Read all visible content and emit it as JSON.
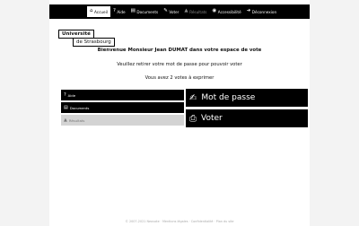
{
  "nav": {
    "items": [
      {
        "icon": "home-icon",
        "glyph": "⌂",
        "label": "Accueil",
        "active": true,
        "disabled": false
      },
      {
        "icon": "help-icon",
        "glyph": "?",
        "label": "Aide",
        "active": false,
        "disabled": false
      },
      {
        "icon": "document-icon",
        "glyph": "▤",
        "label": "Documents",
        "active": false,
        "disabled": false
      },
      {
        "icon": "vote-icon",
        "glyph": "✎",
        "label": "Voter",
        "active": false,
        "disabled": false
      },
      {
        "icon": "results-icon",
        "glyph": "▲",
        "label": "Résultats",
        "active": false,
        "disabled": true
      },
      {
        "icon": "accessibility-icon",
        "glyph": "◉",
        "label": "Accessibilité",
        "active": false,
        "disabled": false
      },
      {
        "icon": "logout-icon",
        "glyph": "➜",
        "label": "Déconnexion",
        "active": false,
        "disabled": false
      }
    ]
  },
  "logo": {
    "line1": "Université",
    "line2": "de Strasbourg"
  },
  "welcome": "Bienvenue Monsieur Jean DUMAT dans votre espace de vote",
  "message_password": "Veuillez retirer votre mot de passe pour pouvoir voter",
  "message_votes": "Vous avez 2 votes à exprimer",
  "menu": [
    {
      "icon": "help-icon",
      "glyph": "?",
      "label": "Aide",
      "disabled": false
    },
    {
      "icon": "document-icon",
      "glyph": "▤",
      "label": "Documents",
      "disabled": false
    },
    {
      "icon": "results-icon",
      "glyph": "▲",
      "label": "Résultats",
      "disabled": true
    }
  ],
  "buttons": {
    "password": {
      "icon": "key-hand-icon",
      "glyph": "✍",
      "label": "Mot de passe"
    },
    "vote": {
      "icon": "ballot-icon",
      "glyph": "⎙",
      "label": "Voter"
    }
  },
  "footer": "© 2007-2021 Neovote · Mentions légales · Confidentialité · Plan du site",
  "colors": {
    "bar": "#000000",
    "disabled": "#d3d3d3",
    "background": "#ffffff"
  }
}
